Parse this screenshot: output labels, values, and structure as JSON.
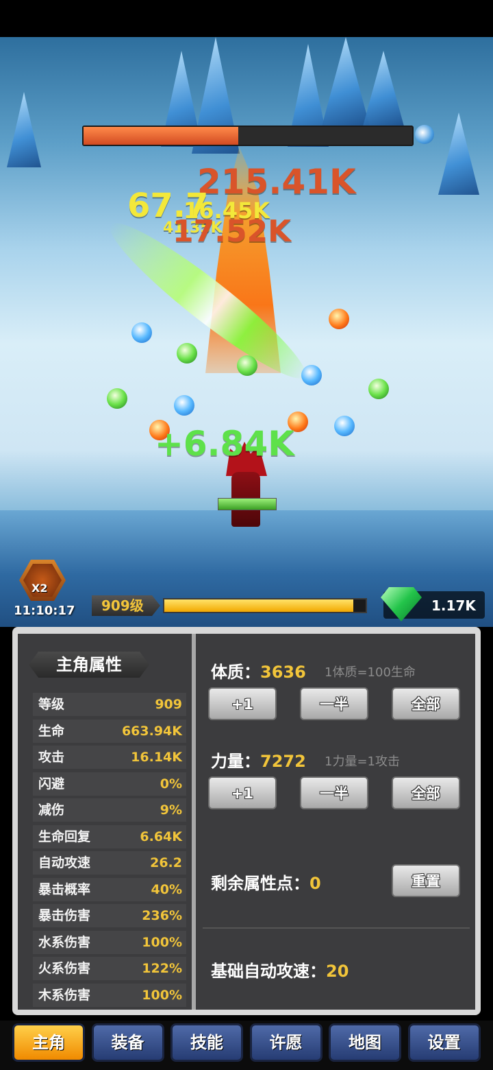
{
  "battle": {
    "damage_numbers": [
      "215.41K",
      "67.7",
      "16.45K",
      "41.35K",
      "17.52K",
      "+6.84K"
    ]
  },
  "hud": {
    "multiplier_badge": "X2",
    "timer": "11:10:17",
    "level_label": "909级",
    "xp_progress": 0.94,
    "gems": "1.17K",
    "boss_hp_progress": 0.47
  },
  "panel": {
    "title": "主角属性",
    "stats": [
      {
        "label": "等级",
        "value": "909"
      },
      {
        "label": "生命",
        "value": "663.94K"
      },
      {
        "label": "攻击",
        "value": "16.14K"
      },
      {
        "label": "闪避",
        "value": "0%"
      },
      {
        "label": "减伤",
        "value": "9%"
      },
      {
        "label": "生命回复",
        "value": "6.64K"
      },
      {
        "label": "自动攻速",
        "value": "26.2"
      },
      {
        "label": "暴击概率",
        "value": "40%"
      },
      {
        "label": "暴击伤害",
        "value": "236%"
      },
      {
        "label": "水系伤害",
        "value": "100%"
      },
      {
        "label": "火系伤害",
        "value": "122%"
      },
      {
        "label": "木系伤害",
        "value": "100%"
      }
    ],
    "constitution": {
      "label": "体质：",
      "value": "3636",
      "note": "1体质=100生命"
    },
    "strength": {
      "label": "力量：",
      "value": "7272",
      "note": "1力量=1攻击"
    },
    "buttons": {
      "plus_one": "+1",
      "half": "一半",
      "all": "全部",
      "reset": "重置"
    },
    "remaining": {
      "label": "剩余属性点：",
      "value": "0"
    },
    "base_speed": {
      "label": "基础自动攻速：",
      "value": "20"
    }
  },
  "nav": {
    "tabs": [
      "主角",
      "装备",
      "技能",
      "许愿",
      "地图",
      "设置"
    ],
    "active_index": 0
  },
  "colors": {
    "accent_gold": "#f2c53a",
    "active_tab": "#f08a00",
    "tab_blue": "#263c73",
    "boss_hp": "#d24b22",
    "gem_green": "#23c44a"
  }
}
